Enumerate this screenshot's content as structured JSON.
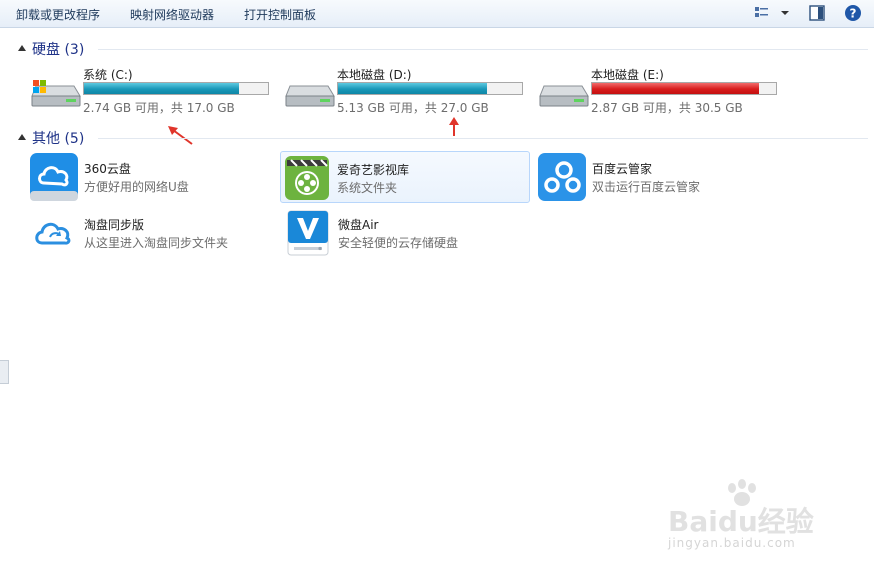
{
  "toolbar": {
    "uninstall_label": "卸载或更改程序",
    "map_drive_label": "映射网络驱动器",
    "control_panel_label": "打开控制面板"
  },
  "groups": {
    "hard_disks": {
      "title": "硬盘 (3)"
    },
    "other": {
      "title": "其他 (5)"
    }
  },
  "drives": [
    {
      "name": "系统 (C:)",
      "info": "2.74 GB 可用，共 17.0 GB",
      "used_fraction": 0.84,
      "bar_color": "blue"
    },
    {
      "name": "本地磁盘 (D:)",
      "info": "5.13 GB 可用，共 27.0 GB",
      "used_fraction": 0.81,
      "bar_color": "blue"
    },
    {
      "name": "本地磁盘 (E:)",
      "info": "2.87 GB 可用，共 30.5 GB",
      "used_fraction": 0.91,
      "bar_color": "red"
    }
  ],
  "items": [
    {
      "name": "360云盘",
      "desc": "方便好用的网络U盘"
    },
    {
      "name": "爱奇艺影视库",
      "desc": "系统文件夹"
    },
    {
      "name": "百度云管家",
      "desc": "双击运行百度云管家"
    },
    {
      "name": "淘盘同步版",
      "desc": "从这里进入淘盘同步文件夹"
    },
    {
      "name": "微盘Air",
      "desc": "安全轻便的云存储硬盘"
    }
  ],
  "watermark": {
    "logo_text": "Baidu经验",
    "url": "jingyan.baidu.com"
  },
  "colors": {
    "bar_blue": "#1a98b8",
    "bar_red": "#d81d1d",
    "group_title": "#1e3287",
    "annotation_arrow": "#e0352b"
  }
}
